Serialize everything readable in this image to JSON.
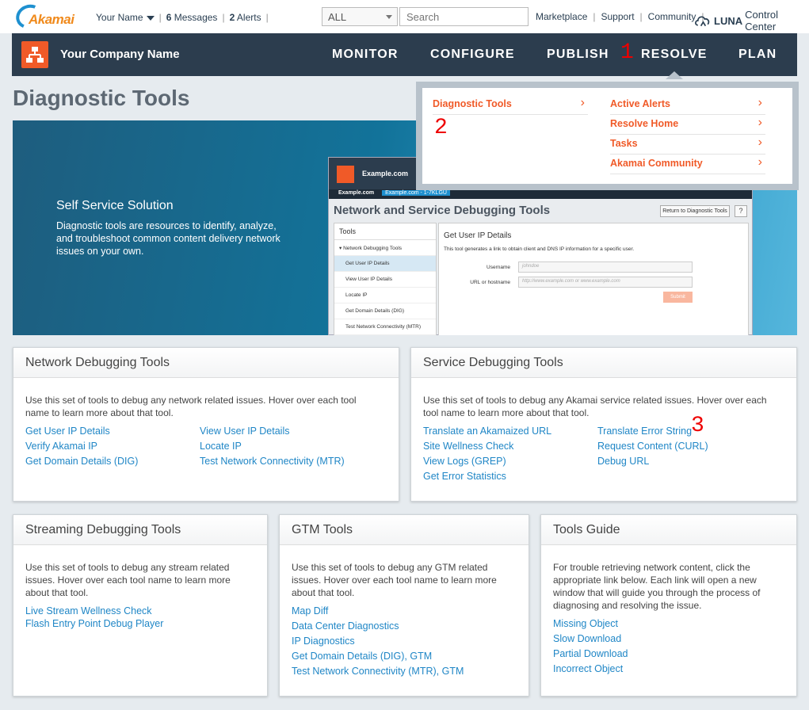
{
  "topbar": {
    "logo_text": "Akamai",
    "user_name": "Your Name",
    "messages_count": "6",
    "messages_label": " Messages",
    "alerts_count": "2",
    "alerts_label": " Alerts",
    "scope_value": "ALL",
    "search_placeholder": "Search",
    "marketplace": "Marketplace",
    "support": "Support",
    "community": "Community",
    "luna_bold": "LUNA",
    "luna_rest": "Control Center"
  },
  "nav": {
    "company": "Your Company Name",
    "items": [
      "MONITOR",
      "CONFIGURE",
      "PUBLISH",
      "RESOLVE",
      "PLAN"
    ]
  },
  "markers": [
    "1",
    "2",
    "3"
  ],
  "page_title": "Diagnostic Tools",
  "hero": {
    "title": "Self Service Solution",
    "description": "Diagnostic tools are resources to identify, analyze, and troubleshoot common content delivery network issues on your own.",
    "mock": {
      "site": "Example.com",
      "crumb_root": "Example.com",
      "crumb_current": "Example.com - 1-7KLGU",
      "title": "Network and Service Debugging Tools",
      "return_button": "Return to Diagnostic Tools",
      "help": "?",
      "tools_header": "Tools",
      "tools": [
        "Network Debugging Tools",
        "Get User IP Details",
        "View User IP Details",
        "Locate IP",
        "Get Domain Details (DIG)",
        "Test Network Connectivity (MTR)"
      ],
      "panel_title": "Get User IP Details",
      "panel_desc": "This tool generates a link to obtain client and DNS IP information for a specific user.",
      "username_label": "Username",
      "username_placeholder": "johndoe",
      "url_label": "URL or hostname",
      "url_placeholder": "http://www.example.com or www.example.com",
      "submit": "Submit"
    }
  },
  "dropdown": {
    "left": [
      "Diagnostic Tools"
    ],
    "right": [
      "Active Alerts",
      "Resolve Home",
      "Tasks",
      "Akamai Community"
    ]
  },
  "cards": {
    "network": {
      "title": "Network Debugging Tools",
      "desc": "Use this set of tools to debug any network related issues. Hover over each tool name to learn more about that tool.",
      "links": [
        "Get User IP Details",
        "Verify Akamai IP",
        "Get Domain Details (DIG)",
        "View User IP Details",
        "Locate IP",
        "Test Network Connectivity (MTR)"
      ]
    },
    "service": {
      "title": "Service Debugging Tools",
      "desc": "Use this set of tools to debug any Akamai service related issues. Hover over each tool name to learn more about that tool.",
      "links": [
        "Translate an Akamaized URL",
        "Site Wellness Check",
        "View Logs (GREP)",
        "Get Error Statistics",
        "Translate Error String",
        "Request Content (CURL)",
        "Debug URL"
      ]
    },
    "streaming": {
      "title": "Streaming Debugging Tools",
      "desc": "Use this set of tools to debug any stream related issues. Hover over each tool name to learn more about that tool.",
      "links": [
        "Live Stream Wellness Check",
        "Flash Entry Point Debug Player"
      ]
    },
    "gtm": {
      "title": "GTM Tools",
      "desc": "Use this set of tools to debug any GTM related issues. Hover over each tool name to learn more about that tool.",
      "links": [
        "Map Diff",
        "Data Center Diagnostics",
        "IP Diagnostics",
        "Get Domain Details (DIG), GTM",
        "Test Network Connectivity (MTR), GTM"
      ]
    },
    "guide": {
      "title": "Tools Guide",
      "desc": "For trouble retrieving network content, click the appropriate link below. Each link will open a new window that will guide you through the process of diagnosing and resolving the issue.",
      "links": [
        "Missing Object",
        "Slow Download",
        "Partial Download",
        "Incorrect Object"
      ]
    }
  },
  "colors": {
    "nav_bg": "#2c3d4e",
    "accent_orange": "#f05a28",
    "link_blue": "#1f86c6",
    "marker_red": "#e00000"
  }
}
